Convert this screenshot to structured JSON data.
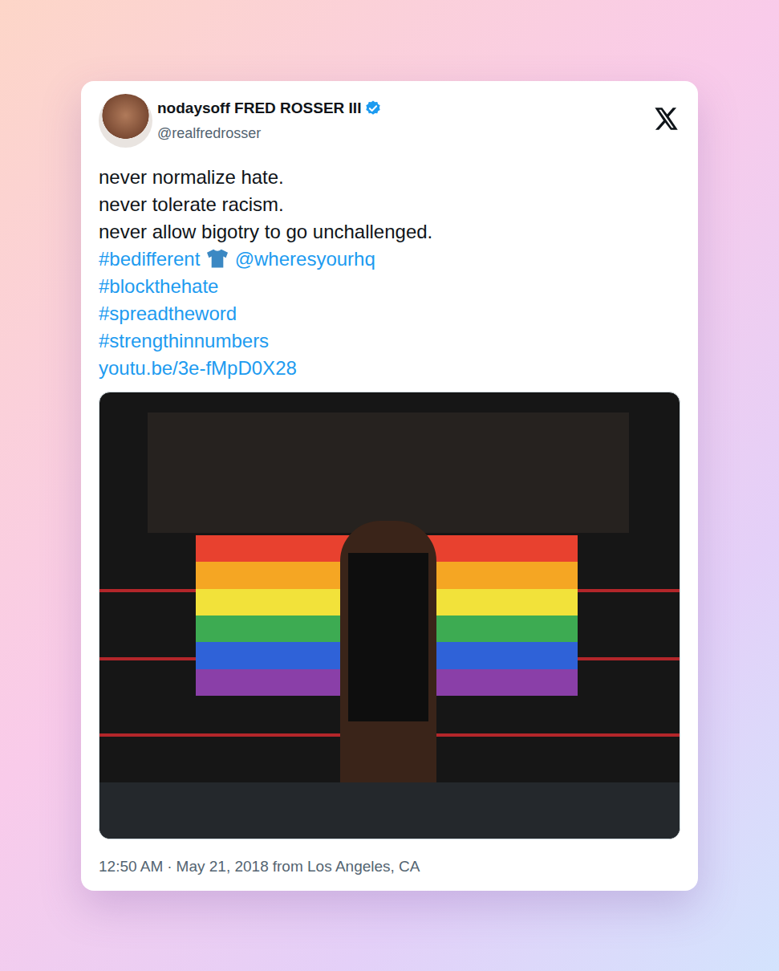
{
  "post": {
    "author": {
      "name": "nodaysoff FRED ROSSER III",
      "handle": "@realfredrosser",
      "verified": true
    },
    "lines": [
      {
        "segments": [
          {
            "kind": "plain",
            "text": "never normalize hate."
          }
        ]
      },
      {
        "segments": [
          {
            "kind": "plain",
            "text": "never tolerate racism."
          }
        ]
      },
      {
        "segments": [
          {
            "kind": "plain",
            "text": "never allow bigotry to go unchallenged."
          }
        ]
      },
      {
        "segments": [
          {
            "kind": "link",
            "text": "#bedifferent"
          },
          {
            "kind": "shirt"
          },
          {
            "kind": "link",
            "text": "@wheresyourhq"
          }
        ]
      },
      {
        "segments": [
          {
            "kind": "link",
            "text": "#blockthehate"
          }
        ]
      },
      {
        "segments": [
          {
            "kind": "link",
            "text": "#spreadtheword"
          }
        ]
      },
      {
        "segments": [
          {
            "kind": "link",
            "text": "#strengthinnumbers"
          }
        ]
      },
      {
        "segments": [
          {
            "kind": "link",
            "text": "youtu.be/3e-fMpD0X28"
          }
        ]
      }
    ],
    "footer": {
      "time": "12:50 AM",
      "separator": "·",
      "date": "May 21, 2018",
      "source": "from Los Angeles, CA"
    }
  }
}
